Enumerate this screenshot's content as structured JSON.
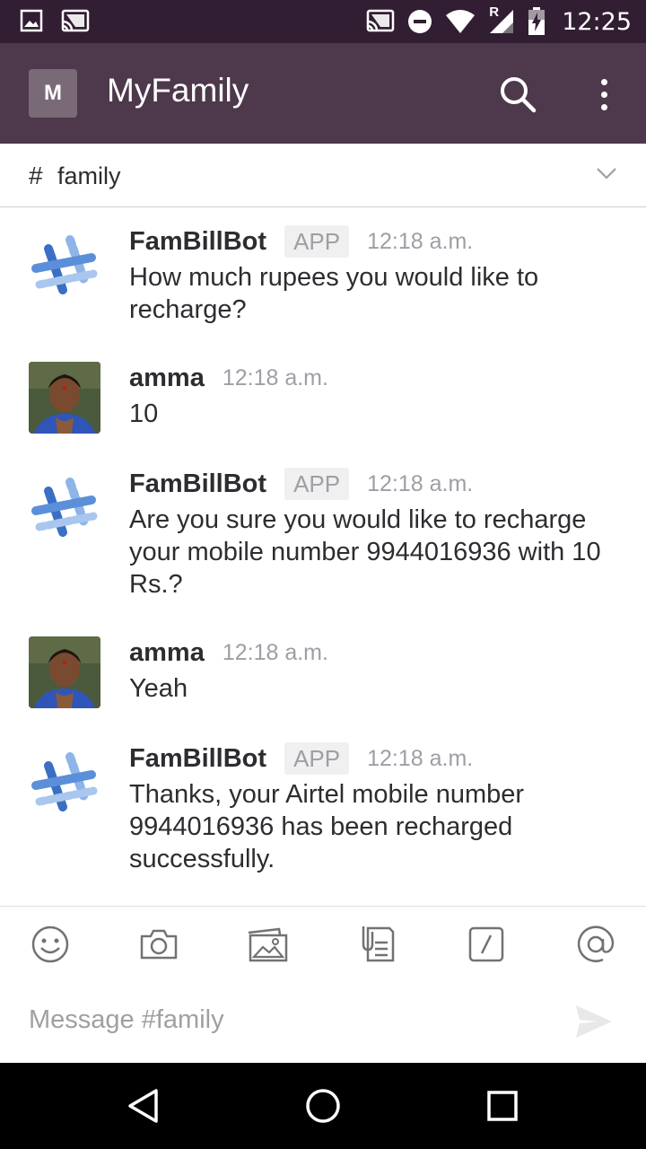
{
  "status_bar": {
    "time": "12:25",
    "icons": [
      "image-icon",
      "cast-icon",
      "cast-icon",
      "do-not-disturb-icon",
      "wifi-icon",
      "signal-roaming-icon",
      "battery-charging-icon"
    ],
    "roaming_label": "R"
  },
  "app_bar": {
    "team_initial": "M",
    "title": "MyFamily",
    "icons": [
      "search-icon",
      "more-vert-icon"
    ]
  },
  "channel": {
    "hash": "#",
    "name": "family"
  },
  "messages": [
    {
      "author": "FamBillBot",
      "badge": "APP",
      "time": "12:18 a.m.",
      "text": "How much rupees you would like to recharge?",
      "avatar": "bot-logo-icon"
    },
    {
      "author": "amma",
      "badge": "",
      "time": "12:18 a.m.",
      "text": "10",
      "avatar": "user-photo"
    },
    {
      "author": "FamBillBot",
      "badge": "APP",
      "time": "12:18 a.m.",
      "text": "Are you sure you would like to recharge your mobile number 9944016936 with 10 Rs.?",
      "avatar": "bot-logo-icon"
    },
    {
      "author": "amma",
      "badge": "",
      "time": "12:18 a.m.",
      "text": "Yeah",
      "avatar": "user-photo"
    },
    {
      "author": "FamBillBot",
      "badge": "APP",
      "time": "12:18 a.m.",
      "text": "Thanks, your Airtel mobile number 9944016936 has been recharged successfully.",
      "avatar": "bot-logo-icon"
    }
  ],
  "composer": {
    "placeholder": "Message #family",
    "icons": [
      "emoji-icon",
      "camera-icon",
      "gallery-icon",
      "file-icon",
      "slash-command-icon",
      "mention-icon",
      "send-icon"
    ]
  },
  "nav_bar": {
    "icons": [
      "back-icon",
      "home-icon",
      "recents-icon"
    ]
  },
  "colors": {
    "status_bar": "#321e33",
    "app_bar": "#4d394b",
    "bot_blue": "#3a6fc4",
    "muted_text": "#9e9ea6"
  }
}
